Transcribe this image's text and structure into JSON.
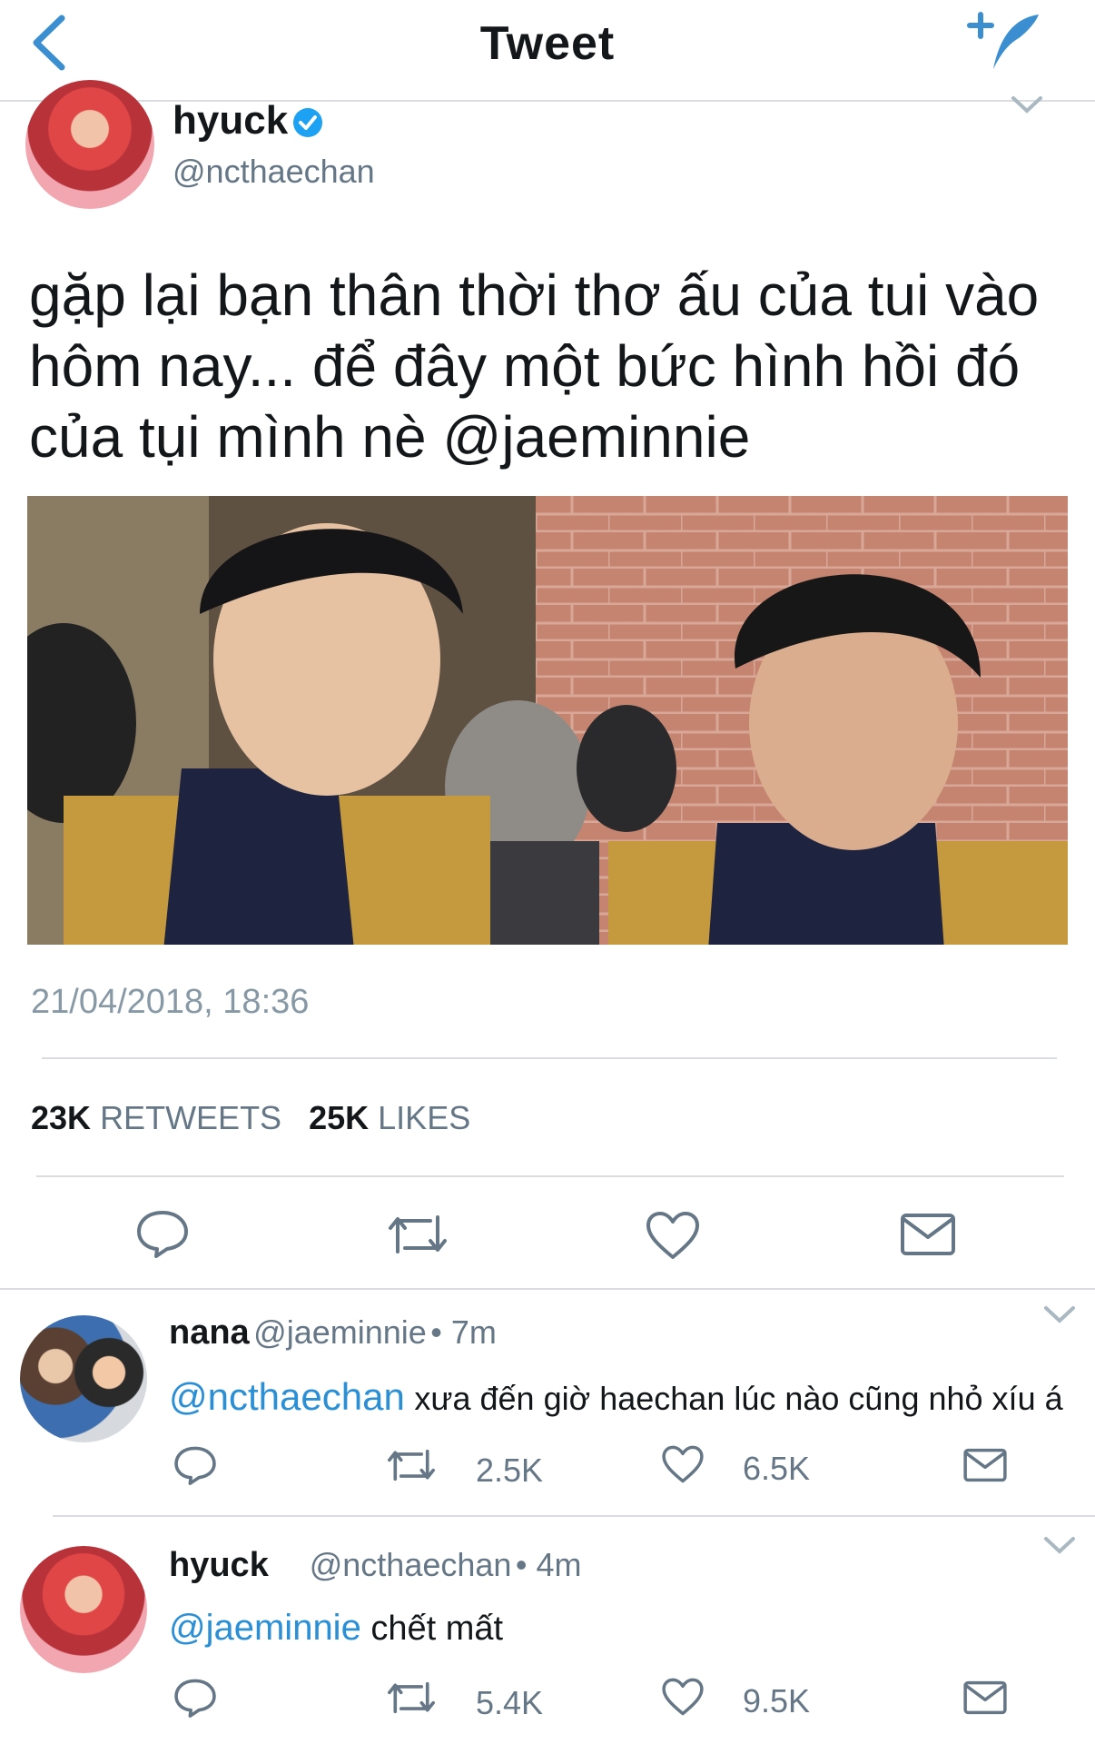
{
  "nav": {
    "title": "Tweet",
    "back_icon": "chevron-left-icon",
    "compose_icon": "compose-tweet-icon"
  },
  "tweet": {
    "author_name": "hyuck",
    "author_handle": "@ncthaechan",
    "verified": true,
    "text_lines": [
      "gặp lại bạn thân thời thơ ấu của tui vào",
      "hôm nay... để đây một bức hình hồi đó",
      "của tụi mình nè @jaeminnie"
    ],
    "timestamp": "21/04/2018, 18:36",
    "retweets_count": "23K",
    "retweets_label": "RETWEETS",
    "likes_count": "25K",
    "likes_label": "LIKES"
  },
  "replies": [
    {
      "name": "nana",
      "handle": "@jaeminnie",
      "time": "• 7m",
      "mention": "@ncthaechan",
      "text": "xưa đến giờ haechan lúc nào cũng nhỏ xíu á",
      "retweets": "2.5K",
      "likes": "6.5K"
    },
    {
      "name": "hyuck",
      "handle": "@ncthaechan",
      "time": "• 4m",
      "mention": "@jaeminnie",
      "text": "chết mất",
      "retweets": "5.4K",
      "likes": "9.5K"
    }
  ],
  "colors": {
    "accent": "#2b8fd6",
    "verified": "#1da1f2",
    "icon": "#657786",
    "text": "#14171a"
  }
}
